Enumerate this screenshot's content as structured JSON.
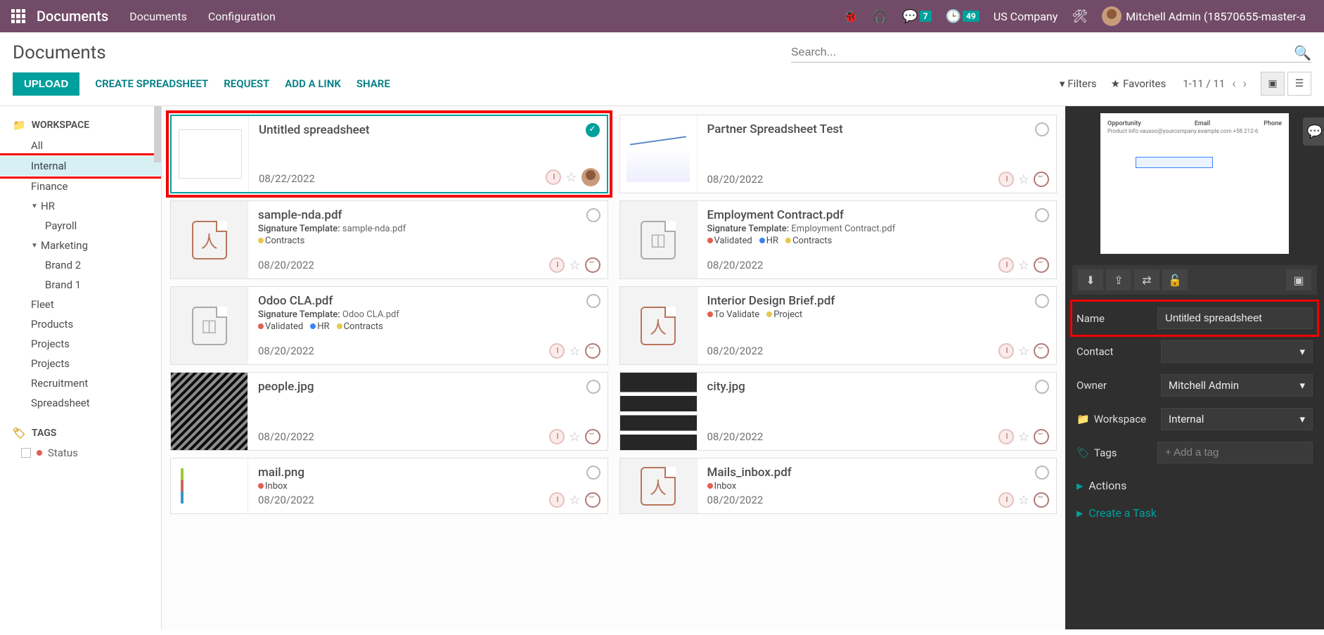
{
  "topbar": {
    "brand": "Documents",
    "nav": [
      "Documents",
      "Configuration"
    ],
    "msg_badge": "7",
    "activity_badge": "49",
    "company": "US Company",
    "user": "Mitchell Admin (18570655-master-a"
  },
  "header": {
    "title": "Documents",
    "search_placeholder": "Search..."
  },
  "toolbar": {
    "upload": "UPLOAD",
    "create_spreadsheet": "CREATE SPREADSHEET",
    "request": "REQUEST",
    "add_link": "ADD A LINK",
    "share": "SHARE",
    "filters": "Filters",
    "favorites": "Favorites",
    "pager": "1-11 / 11"
  },
  "sidebar": {
    "workspace_head": "WORKSPACE",
    "tags_head": "TAGS",
    "items": {
      "all": "All",
      "internal": "Internal",
      "finance": "Finance",
      "hr": "HR",
      "payroll": "Payroll",
      "marketing": "Marketing",
      "brand2": "Brand 2",
      "brand1": "Brand 1",
      "fleet": "Fleet",
      "products": "Products",
      "projects1": "Projects",
      "projects2": "Projects",
      "recruitment": "Recruitment",
      "spreadsheet": "Spreadsheet"
    },
    "tags": {
      "status": "Status"
    }
  },
  "cards": {
    "c0": {
      "title": "Untitled spreadsheet",
      "date": "08/22/2022"
    },
    "c1": {
      "title": "Partner Spreadsheet Test",
      "date": "08/20/2022"
    },
    "c2": {
      "title": "sample-nda.pdf",
      "sig_label": "Signature Template:",
      "sig_value": "sample-nda.pdf",
      "tag1": "Contracts",
      "date": "08/20/2022"
    },
    "c3": {
      "title": "Employment Contract.pdf",
      "sig_label": "Signature Template:",
      "sig_value": "Employment Contract.pdf",
      "tag1": "Validated",
      "tag2": "HR",
      "tag3": "Contracts",
      "date": "08/20/2022"
    },
    "c4": {
      "title": "Odoo CLA.pdf",
      "sig_label": "Signature Template:",
      "sig_value": "Odoo CLA.pdf",
      "tag1": "Validated",
      "tag2": "HR",
      "tag3": "Contracts",
      "date": "08/20/2022"
    },
    "c5": {
      "title": "Interior Design Brief.pdf",
      "tag1": "To Validate",
      "tag2": "Project",
      "date": "08/20/2022"
    },
    "c6": {
      "title": "people.jpg",
      "date": "08/20/2022"
    },
    "c7": {
      "title": "city.jpg",
      "date": "08/20/2022"
    },
    "c8": {
      "title": "mail.png",
      "tag1": "Inbox",
      "date": "08/20/2022"
    },
    "c9": {
      "title": "Mails_inbox.pdf",
      "tag1": "Inbox",
      "date": "08/20/2022"
    }
  },
  "details": {
    "preview_head": {
      "opp": "Opportunity",
      "email": "Email",
      "phone": "Phone"
    },
    "preview_row": "Product Info    vauxoo@yourcompany.example.com    +58 212-6",
    "name_label": "Name",
    "name_value": "Untitled spreadsheet",
    "contact_label": "Contact",
    "owner_label": "Owner",
    "owner_value": "Mitchell Admin",
    "workspace_label": "Workspace",
    "workspace_value": "Internal",
    "tags_label": "Tags",
    "tags_placeholder": "+ Add a tag",
    "actions": "Actions",
    "create_task": "Create a Task"
  }
}
